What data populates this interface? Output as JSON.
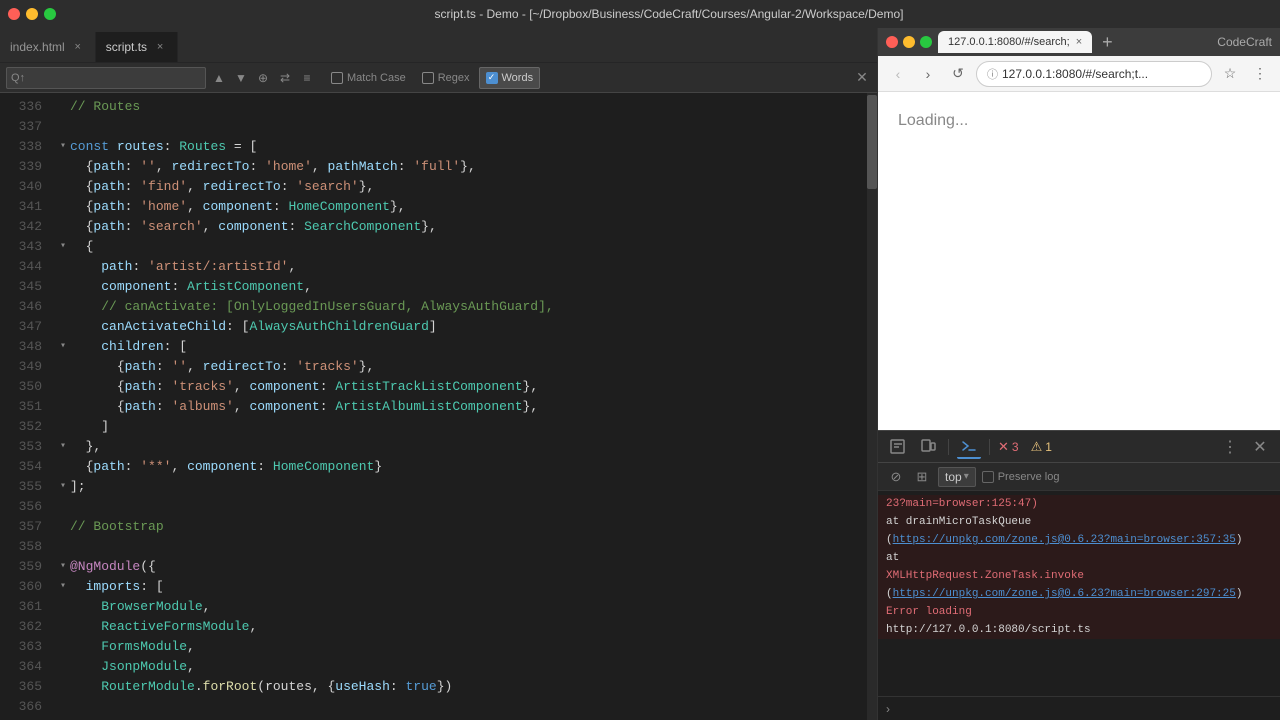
{
  "titleBar": {
    "title": "script.ts - Demo - [~/Dropbox/Business/CodeCraft/Courses/Angular-2/Workspace/Demo]"
  },
  "editor": {
    "tabs": [
      {
        "label": "index.html",
        "active": false
      },
      {
        "label": "script.ts",
        "active": true
      }
    ],
    "search": {
      "value": "Q↑",
      "matchCase": {
        "label": "Match Case",
        "checked": false
      },
      "regex": {
        "label": "Regex",
        "checked": false
      },
      "words": {
        "label": "Words",
        "checked": true
      }
    },
    "lines": [
      {
        "num": "336",
        "indent": 0,
        "fold": false,
        "code": "// Routes",
        "type": "comment"
      },
      {
        "num": "337",
        "indent": 0,
        "fold": false,
        "code": ""
      },
      {
        "num": "338",
        "indent": 0,
        "fold": true,
        "code": "const routes: Routes = ["
      },
      {
        "num": "339",
        "indent": 1,
        "fold": false,
        "code": "  {path: '', redirectTo: 'home', pathMatch: 'full'},"
      },
      {
        "num": "340",
        "indent": 1,
        "fold": false,
        "code": "  {path: 'find', redirectTo: 'search'},"
      },
      {
        "num": "341",
        "indent": 1,
        "fold": false,
        "code": "  {path: 'home', component: HomeComponent},"
      },
      {
        "num": "342",
        "indent": 1,
        "fold": false,
        "code": "  {path: 'search', component: SearchComponent},"
      },
      {
        "num": "343",
        "indent": 1,
        "fold": true,
        "code": "  {"
      },
      {
        "num": "344",
        "indent": 2,
        "fold": false,
        "code": "    path: 'artist/:artistId',"
      },
      {
        "num": "345",
        "indent": 2,
        "fold": false,
        "code": "    component: ArtistComponent,"
      },
      {
        "num": "346",
        "indent": 2,
        "fold": false,
        "code": "    // canActivate: [OnlyLoggedInUsersGuard, AlwaysAuthGuard],"
      },
      {
        "num": "347",
        "indent": 2,
        "fold": false,
        "code": "    canActivateChild: [AlwaysAuthChildrenGuard]"
      },
      {
        "num": "348",
        "indent": 2,
        "fold": true,
        "code": "    children: ["
      },
      {
        "num": "349",
        "indent": 3,
        "fold": false,
        "code": "      {path: '', redirectTo: 'tracks'},"
      },
      {
        "num": "350",
        "indent": 3,
        "fold": false,
        "code": "      {path: 'tracks', component: ArtistTrackListComponent},"
      },
      {
        "num": "351",
        "indent": 3,
        "fold": false,
        "code": "      {path: 'albums', component: ArtistAlbumListComponent},"
      },
      {
        "num": "352",
        "indent": 3,
        "fold": false,
        "code": "    ]"
      },
      {
        "num": "353",
        "indent": 1,
        "fold": true,
        "code": "  },"
      },
      {
        "num": "354",
        "indent": 1,
        "fold": false,
        "code": "  {path: '**', component: HomeComponent}"
      },
      {
        "num": "355",
        "indent": 0,
        "fold": true,
        "code": "];"
      },
      {
        "num": "356",
        "indent": 0,
        "fold": false,
        "code": ""
      },
      {
        "num": "357",
        "indent": 0,
        "fold": false,
        "code": "// Bootstrap",
        "type": "comment"
      },
      {
        "num": "358",
        "indent": 0,
        "fold": false,
        "code": ""
      },
      {
        "num": "359",
        "indent": 0,
        "fold": true,
        "code": "@NgModule({"
      },
      {
        "num": "360",
        "indent": 1,
        "fold": true,
        "code": "  imports: ["
      },
      {
        "num": "361",
        "indent": 2,
        "fold": false,
        "code": "    BrowserModule,"
      },
      {
        "num": "362",
        "indent": 2,
        "fold": false,
        "code": "    ReactiveFormsModule,"
      },
      {
        "num": "363",
        "indent": 2,
        "fold": false,
        "code": "    FormsModule,"
      },
      {
        "num": "364",
        "indent": 2,
        "fold": false,
        "code": "    JsonpModule,"
      },
      {
        "num": "365",
        "indent": 2,
        "fold": false,
        "code": "    RouterModule.forRoot(routes, {useHash: true})"
      },
      {
        "num": "366",
        "indent": 0,
        "fold": false,
        "code": ""
      }
    ]
  },
  "browser": {
    "url": "127.0.0.1:8080/#/search;t...",
    "tab": {
      "label": "127.0.0.1:8080/#/search;"
    },
    "appName": "CodeCraft",
    "content": {
      "loading": "Loading..."
    }
  },
  "devtools": {
    "errorCount": "3",
    "warnCount": "1",
    "filter": {
      "level": "top",
      "preserveLog": "Preserve log"
    },
    "console": [
      {
        "type": "error",
        "text": "23?main=browser:125:47)"
      },
      {
        "type": "error-sub",
        "text": "    at drainMicroTaskQueue"
      },
      {
        "type": "error-link",
        "text": "(https://unpkg.com/zone.js@0.6.23?main=browser:357:35)"
      },
      {
        "type": "error-sub",
        "text": "    at"
      },
      {
        "type": "error-name",
        "text": "XMLHttpRequest.ZoneTask.invoke"
      },
      {
        "type": "error-link",
        "text": "(https://unpkg.com/zone.js@0.6.23?main=browser:297:25)"
      },
      {
        "type": "error",
        "text": "  Error loading"
      },
      {
        "type": "error-sub",
        "text": "http://127.0.0.1:8080/script.ts"
      }
    ]
  }
}
